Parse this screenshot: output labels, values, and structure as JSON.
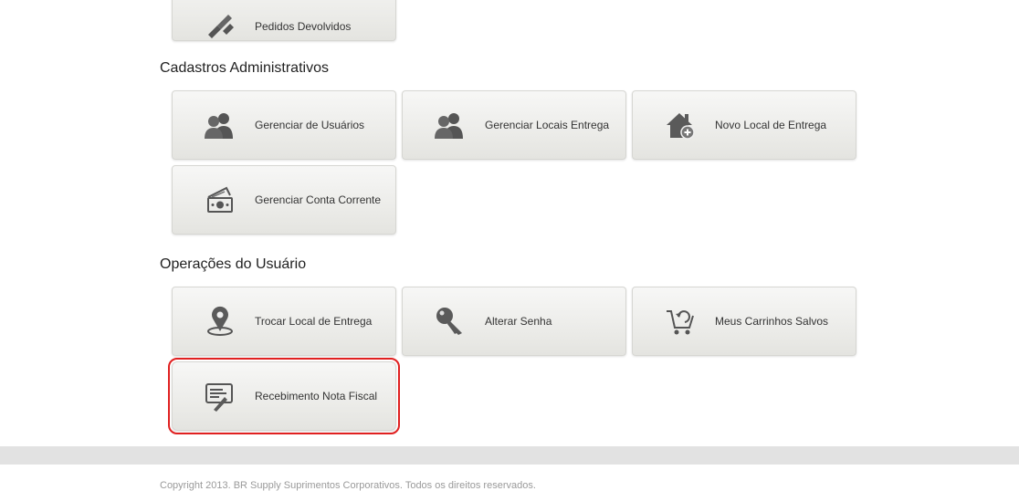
{
  "top_tile": {
    "label": "Pedidos Devolvidos",
    "icon": "tools-icon"
  },
  "sections": [
    {
      "title": "Cadastros Administrativos",
      "tiles": [
        {
          "label": "Gerenciar de Usuários",
          "icon": "users-icon"
        },
        {
          "label": "Gerenciar Locais Entrega",
          "icon": "users-icon"
        },
        {
          "label": "Novo Local de Entrega",
          "icon": "house-add-icon"
        },
        {
          "label": "Gerenciar Conta Corrente",
          "icon": "money-icon"
        }
      ]
    },
    {
      "title": "Operações do Usuário",
      "tiles": [
        {
          "label": "Trocar Local de Entrega",
          "icon": "map-pin-icon"
        },
        {
          "label": "Alterar Senha",
          "icon": "key-icon"
        },
        {
          "label": "Meus Carrinhos Salvos",
          "icon": "cart-icon"
        },
        {
          "label": "Recebimento Nota Fiscal",
          "icon": "invoice-icon"
        }
      ]
    }
  ],
  "highlight_color": "#e02020",
  "footer": {
    "copyright": "Copyright 2013. BR Supply Suprimentos Corporativos. Todos os direitos reservados."
  }
}
